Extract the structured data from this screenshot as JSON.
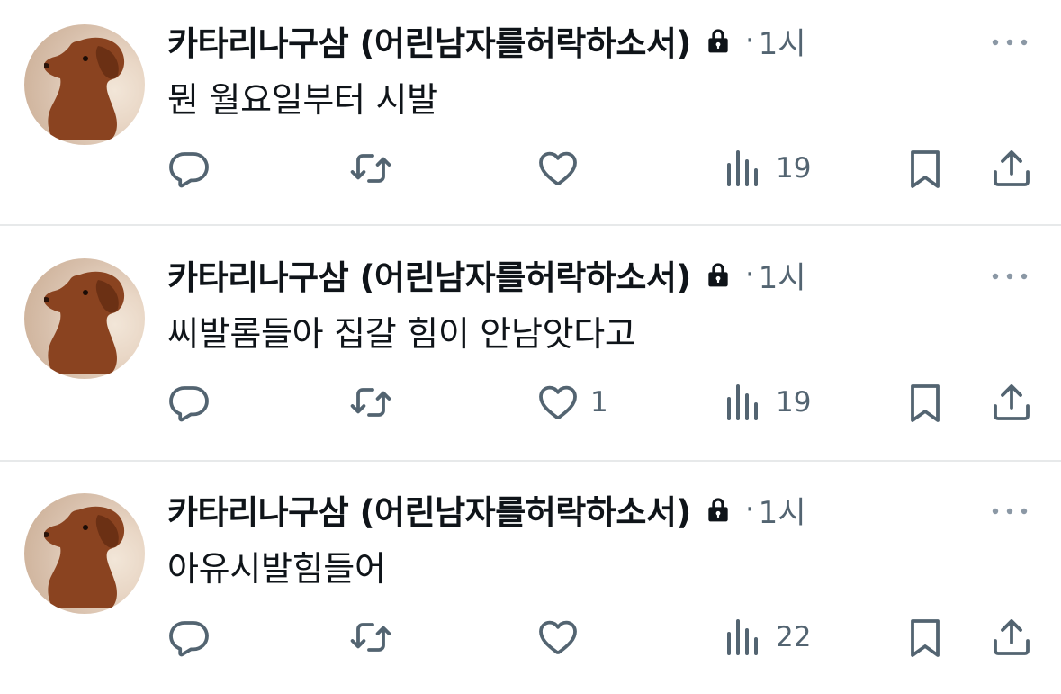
{
  "tweets": [
    {
      "author": "카타리나구삼 (어린남자를허락하소서)",
      "separator": "·",
      "time": "1시",
      "text": "뭔 월요일부터 시발",
      "reply_count": "",
      "retweet_count": "",
      "like_count": "",
      "view_count": "19"
    },
    {
      "author": "카타리나구삼 (어린남자를허락하소서)",
      "separator": "·",
      "time": "1시",
      "text": "씨발롬들아 집갈 힘이 안남앗다고",
      "reply_count": "",
      "retweet_count": "",
      "like_count": "1",
      "view_count": "19"
    },
    {
      "author": "카타리나구삼 (어린남자를허락하소서)",
      "separator": "·",
      "time": "1시",
      "text": "아유시발힘들어",
      "reply_count": "",
      "retweet_count": "",
      "like_count": "",
      "view_count": "22"
    }
  ],
  "icons": {
    "reply": "reply-icon",
    "retweet": "retweet-icon",
    "like": "heart-icon",
    "views": "views-icon",
    "bookmark": "bookmark-icon",
    "share": "share-icon",
    "more": "more-icon",
    "lock": "lock-icon"
  },
  "colors": {
    "text": "#0f1419",
    "secondary": "#536471",
    "divider": "#e7e9ea"
  }
}
